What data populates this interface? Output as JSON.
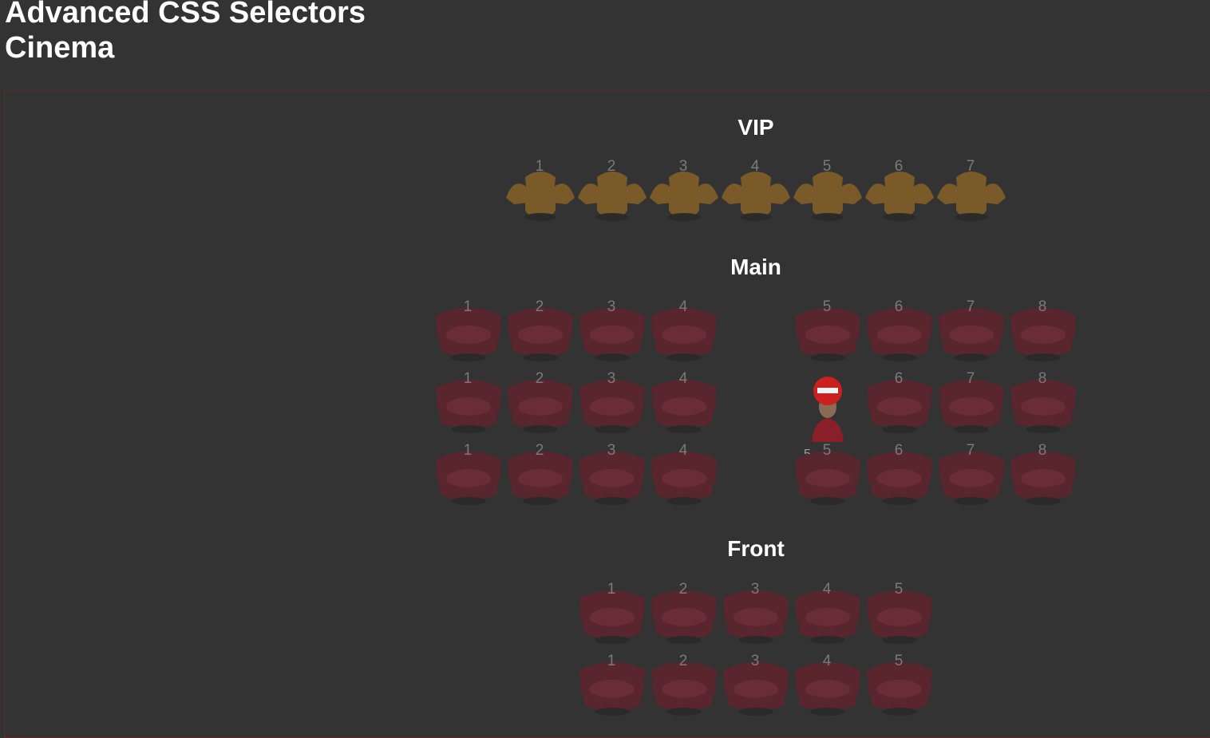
{
  "page": {
    "title": "Advanced CSS Selectors",
    "subtitle": "Cinema"
  },
  "sections": {
    "vip": {
      "title": "VIP",
      "seats": [
        "1",
        "2",
        "3",
        "4",
        "5",
        "6",
        "7"
      ]
    },
    "main": {
      "title": "Main",
      "rows": [
        [
          "1",
          "2",
          "3",
          "4",
          "5",
          "6",
          "7",
          "8"
        ],
        [
          "1",
          "2",
          "3",
          "4",
          "5",
          "6",
          "7",
          "8"
        ],
        [
          "1",
          "2",
          "3",
          "4",
          "5",
          "6",
          "7",
          "8"
        ]
      ],
      "occupied": {
        "row": 2,
        "seat": "5"
      }
    },
    "front": {
      "title": "Front",
      "rows": [
        [
          "1",
          "2",
          "3",
          "4",
          "5"
        ],
        [
          "1",
          "2",
          "3",
          "4",
          "5"
        ]
      ]
    }
  },
  "colors": {
    "background": "#333333",
    "vip_seat": "#7a5a28",
    "regular_seat": "#5a262e",
    "occupant_cap": "#cc1f1f"
  },
  "icons": {
    "vip_seat": "armchair-icon",
    "regular_seat": "tub-chair-icon",
    "occupant": "person-with-cap-icon"
  }
}
